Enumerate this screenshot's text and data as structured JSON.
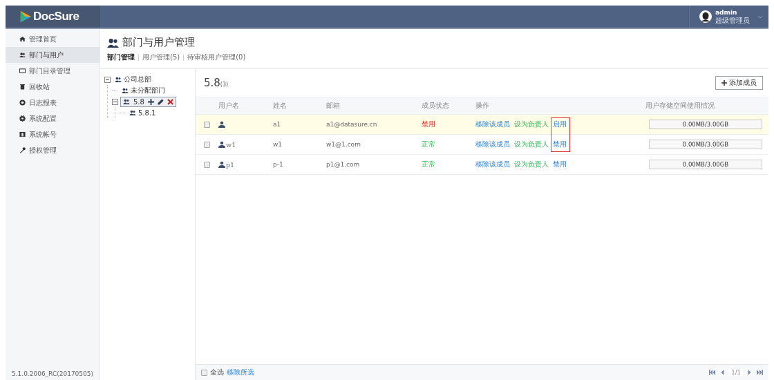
{
  "header": {
    "logo": "DocSure",
    "user": {
      "name": "admin",
      "role": "超级管理员"
    }
  },
  "sidebar": {
    "items": [
      {
        "label": "管理首页",
        "kind": "home",
        "selected": false
      },
      {
        "label": "部门与用户",
        "kind": "users",
        "selected": true
      },
      {
        "label": "部门目录管理",
        "kind": "folder",
        "selected": false
      },
      {
        "label": "回收站",
        "kind": "trash",
        "selected": false
      },
      {
        "label": "日志报表",
        "kind": "log",
        "selected": false
      },
      {
        "label": "系统配置",
        "kind": "gear",
        "selected": false
      },
      {
        "label": "系统帐号",
        "kind": "card",
        "selected": false
      },
      {
        "label": "授权管理",
        "kind": "key",
        "selected": false
      }
    ],
    "version": "5.1.0.2006_RC(20170505)"
  },
  "page": {
    "title": "部门与用户管理",
    "tabs": [
      {
        "label": "部门管理",
        "selected": true
      },
      {
        "label": "用户管理(5)",
        "selected": false
      },
      {
        "label": "待审核用户管理(0)",
        "selected": false
      }
    ]
  },
  "tree": {
    "nodes": [
      {
        "label": "公司总部",
        "expanded": true,
        "selected": false,
        "children": [
          {
            "label": "未分配部门",
            "selected": false
          },
          {
            "label": "5.8",
            "expanded": true,
            "selected": true,
            "children": [
              {
                "label": "5.8.1",
                "selected": false
              }
            ]
          }
        ]
      }
    ]
  },
  "table": {
    "title": "5.8",
    "count": "(3)",
    "add_button": "添加成员",
    "columns": [
      "用户名",
      "姓名",
      "邮箱",
      "成员状态",
      "操作",
      "用户存储空间使用情况"
    ],
    "rows": [
      {
        "name": "a1",
        "email": "a1@datasure.cn",
        "status": "禁用",
        "enabled": false,
        "actions": [
          "移除该成员",
          "设为负责人"
        ],
        "toggle": "启用",
        "framed": true,
        "usage": "0.00MB/3.00GB",
        "selected": true,
        "checked": false
      },
      {
        "username": "w1",
        "name": "w1",
        "email": "w1@1.com",
        "status": "正常",
        "enabled": true,
        "actions": [
          "移除该成员",
          "设为负责人"
        ],
        "toggle": "禁用",
        "framed": true,
        "usage": "0.00MB/3.00GB",
        "selected": false,
        "checked": false
      },
      {
        "username": "p1",
        "name": "p-1",
        "email": "p1@1.com",
        "status": "正常",
        "enabled": true,
        "actions": [
          "移除该成员",
          "设为负责人"
        ],
        "toggle": "禁用",
        "framed": false,
        "usage": "0.00MB/3.00GB",
        "selected": false,
        "checked": false
      }
    ],
    "footer": {
      "select_all": "全选",
      "select_all_checked": false,
      "remove_selected": "移除所选",
      "page": "1/1"
    }
  }
}
